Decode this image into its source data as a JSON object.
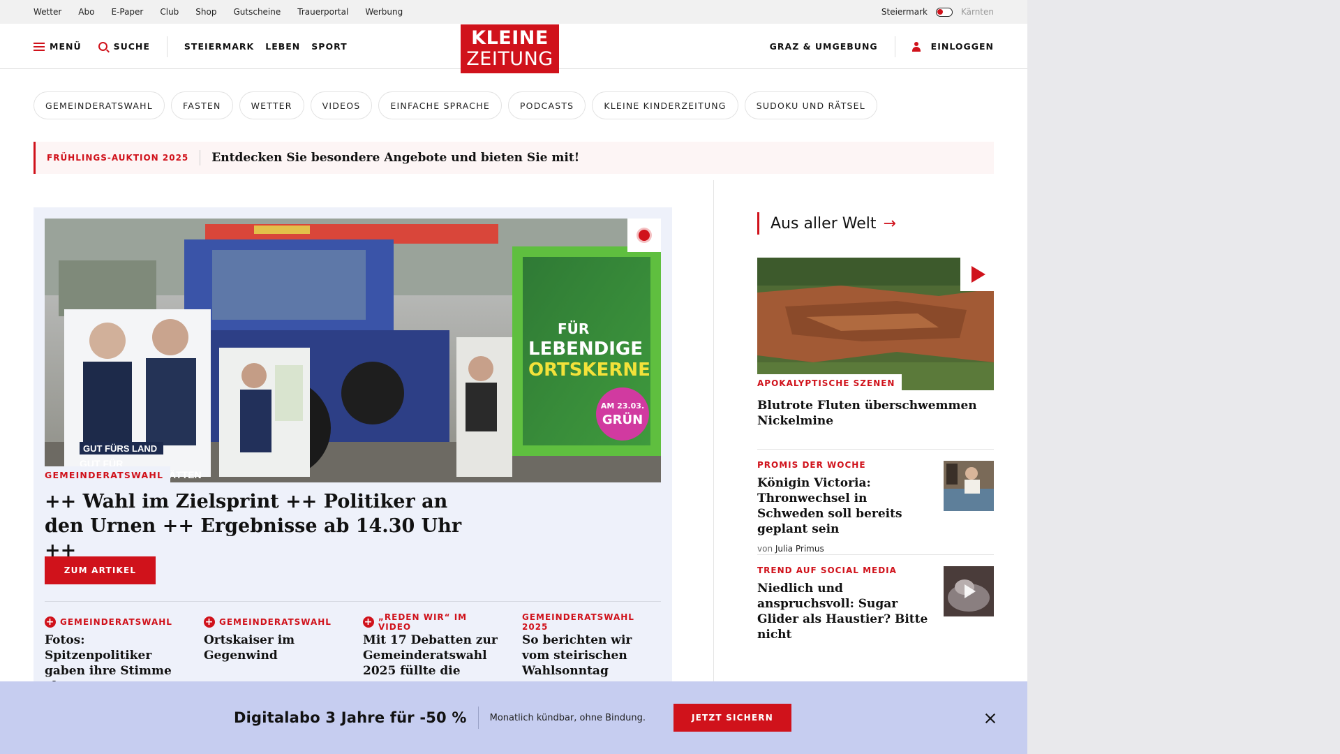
{
  "utility_nav": {
    "links": [
      "Wetter",
      "Abo",
      "E-Paper",
      "Club",
      "Shop",
      "Gutscheine",
      "Trauerportal",
      "Werbung"
    ],
    "region_active": "Steiermark",
    "region_inactive": "Kärnten"
  },
  "header": {
    "menu_label": "MENÜ",
    "search_label": "SUCHE",
    "nav": [
      "STEIERMARK",
      "LEBEN",
      "SPORT"
    ],
    "logo_line1": "KLEINE",
    "logo_line2": "ZEITUNG",
    "region_link": "GRAZ & UMGEBUNG",
    "login_label": "EINLOGGEN"
  },
  "topic_pills": [
    "GEMEINDERATSWAHL",
    "FASTEN",
    "WETTER",
    "VIDEOS",
    "EINFACHE SPRACHE",
    "PODCASTS",
    "KLEINE KINDERZEITUNG",
    "SUDOKU UND RÄTSEL"
  ],
  "promo": {
    "kicker": "FRÜHLINGS-AUKTION 2025",
    "text": "Entdecken Sie besondere Angebote und bieten Sie mit!"
  },
  "lead": {
    "kicker": "GEMEINDERATSWAHL",
    "title": "++ Wahl im Zielsprint ++ Politiker an den Urnen ++ Ergebnisse ab 14.30 Uhr ++",
    "cta": "ZUM ARTIKEL",
    "image_texts": {
      "poster_slogan1": "GUT FÜRS LAND",
      "poster_slogan2": "GUT FÜR",
      "poster_slogan3": "STÄTTEN",
      "green_poster_line1": "FÜR",
      "green_poster_line2": "LEBENDIGE",
      "green_poster_line3": "ORTSKERNE",
      "badge_line1": "AM 23.03.",
      "badge_line2": "GRÜN"
    },
    "sub_articles": [
      {
        "kicker": "GEMEINDERATSWAHL",
        "plus": true,
        "title": "Fotos: Spitzenpolitiker gaben ihre Stimme ab"
      },
      {
        "kicker": "GEMEINDERATSWAHL",
        "plus": true,
        "title": "Ortskaiser im Gegenwind"
      },
      {
        "kicker": "„REDEN WIR“ IM VIDEO",
        "plus": true,
        "title": "Mit 17 Debatten zur Gemeinderatswahl 2025 füllte die"
      },
      {
        "kicker": "GEMEINDERATSWAHL 2025",
        "plus": false,
        "title": "So berichten wir vom steirischen Wahlsonntag"
      }
    ]
  },
  "sidebar": {
    "section_title": "Aus aller Welt",
    "featured": {
      "kicker": "APOKALYPTISCHE SZENEN",
      "title": "Blutrote Fluten überschwemmen Nickelmine"
    },
    "items": [
      {
        "kicker": "PROMIS DER WOCHE",
        "title": "Königin Victoria: Thronwechsel in Schweden soll bereits geplant sein",
        "by_prefix": "von",
        "author": "Julia Primus"
      },
      {
        "kicker": "TREND AUF SOCIAL MEDIA",
        "title": "Niedlich und anspruchsvoll: Sugar Glider als Haustier? Bitte nicht"
      }
    ]
  },
  "abo_banner": {
    "title": "Digitalabo 3 Jahre für -50 %",
    "subtitle": "Monatlich kündbar, ohne Bindung.",
    "button": "JETZT SICHERN"
  },
  "colors": {
    "brand_red": "#d0121b",
    "banner_bg": "#c6cdf0",
    "lead_bg": "#eef1fa"
  }
}
